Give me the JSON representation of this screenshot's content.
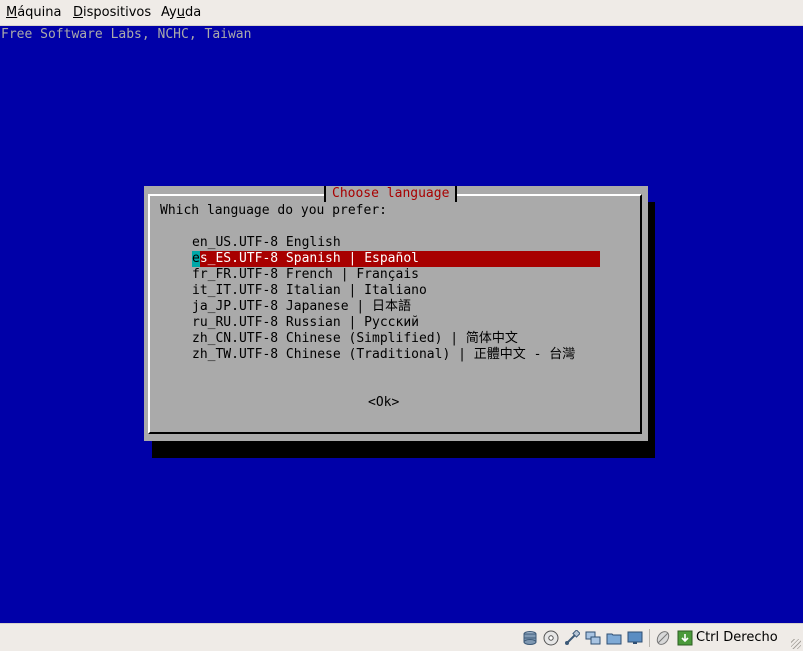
{
  "menubar": {
    "items": [
      {
        "accel": "M",
        "rest": "áquina"
      },
      {
        "accel": "D",
        "rest": "ispositivos"
      },
      {
        "accel": "",
        "pre": "Ay",
        "accel2": "u",
        "rest": "da"
      }
    ]
  },
  "screen": {
    "backtitle": "Free Software Labs, NCHC, Taiwan",
    "dialog": {
      "title": "Choose language",
      "prompt": "Which language do you prefer:",
      "options": [
        "en_US.UTF-8 English",
        "es_ES.UTF-8 Spanish | Español",
        "fr_FR.UTF-8 French | Français",
        "it_IT.UTF-8 Italian | Italiano",
        "ja_JP.UTF-8 Japanese | 日本語",
        "ru_RU.UTF-8 Russian | Русский",
        "zh_CN.UTF-8 Chinese (Simplified) | 简体中文",
        "zh_TW.UTF-8 Chinese (Traditional) | 正體中文 - 台灣"
      ],
      "selected_first_char": "e",
      "selected_rest": "s_ES.UTF-8 Spanish | Español",
      "ok_label": "<Ok>"
    }
  },
  "statusbar": {
    "icons": [
      "hard-disk-icon",
      "cd-icon",
      "usb-icon",
      "network-icon",
      "shared-folder-icon",
      "display-icon",
      "mouse-integration-icon",
      "keyboard-capture-icon"
    ],
    "host_key_label": "Ctrl Derecho"
  },
  "colors": {
    "screen_bg": "#0000a8",
    "dialog_bg": "#aaaaaa",
    "title_red": "#a80000",
    "selection_bg": "#a80000",
    "cursor_cyan": "#00a8a8"
  }
}
